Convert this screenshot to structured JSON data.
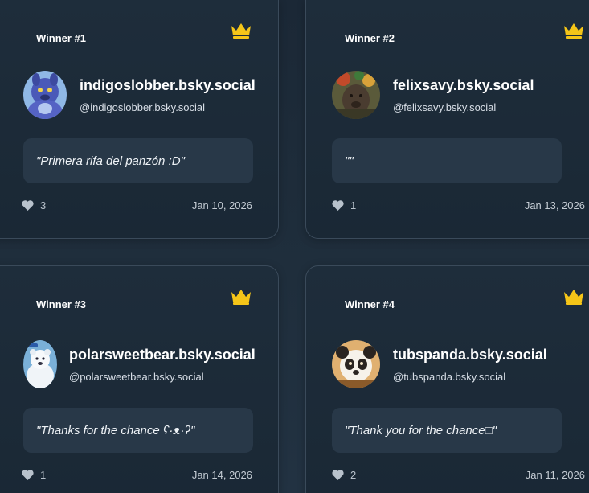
{
  "winners": [
    {
      "label": "Winner #1",
      "display_name": "indigoslobber.bsky.social",
      "handle": "@indigoslobber.bsky.social",
      "message": "\"Primera rifa del panzón :D\"",
      "likes": "3",
      "date": "Jan 10, 2026"
    },
    {
      "label": "Winner #2",
      "display_name": "felixsavy.bsky.social",
      "handle": "@felixsavy.bsky.social",
      "message": "\"\"",
      "likes": "1",
      "date": "Jan 13, 2026"
    },
    {
      "label": "Winner #3",
      "display_name": "polarsweetbear.bsky.social",
      "handle": "@polarsweetbear.bsky.social",
      "message": "\"Thanks for the chance ʕ·ᴥ·ʔ\"",
      "likes": "1",
      "date": "Jan 14, 2026"
    },
    {
      "label": "Winner #4",
      "display_name": "tubspanda.bsky.social",
      "handle": "@tubspanda.bsky.social",
      "message": "\"Thank you for the chance□\"",
      "likes": "2",
      "date": "Jan 11, 2026"
    }
  ],
  "icons": {
    "crown": "crown-icon",
    "heart": "heart-icon"
  },
  "colors": {
    "crown": "#f5c518",
    "background": "#1c2a38",
    "card_border": "#3a4a5a",
    "quote_box": "#283848"
  }
}
